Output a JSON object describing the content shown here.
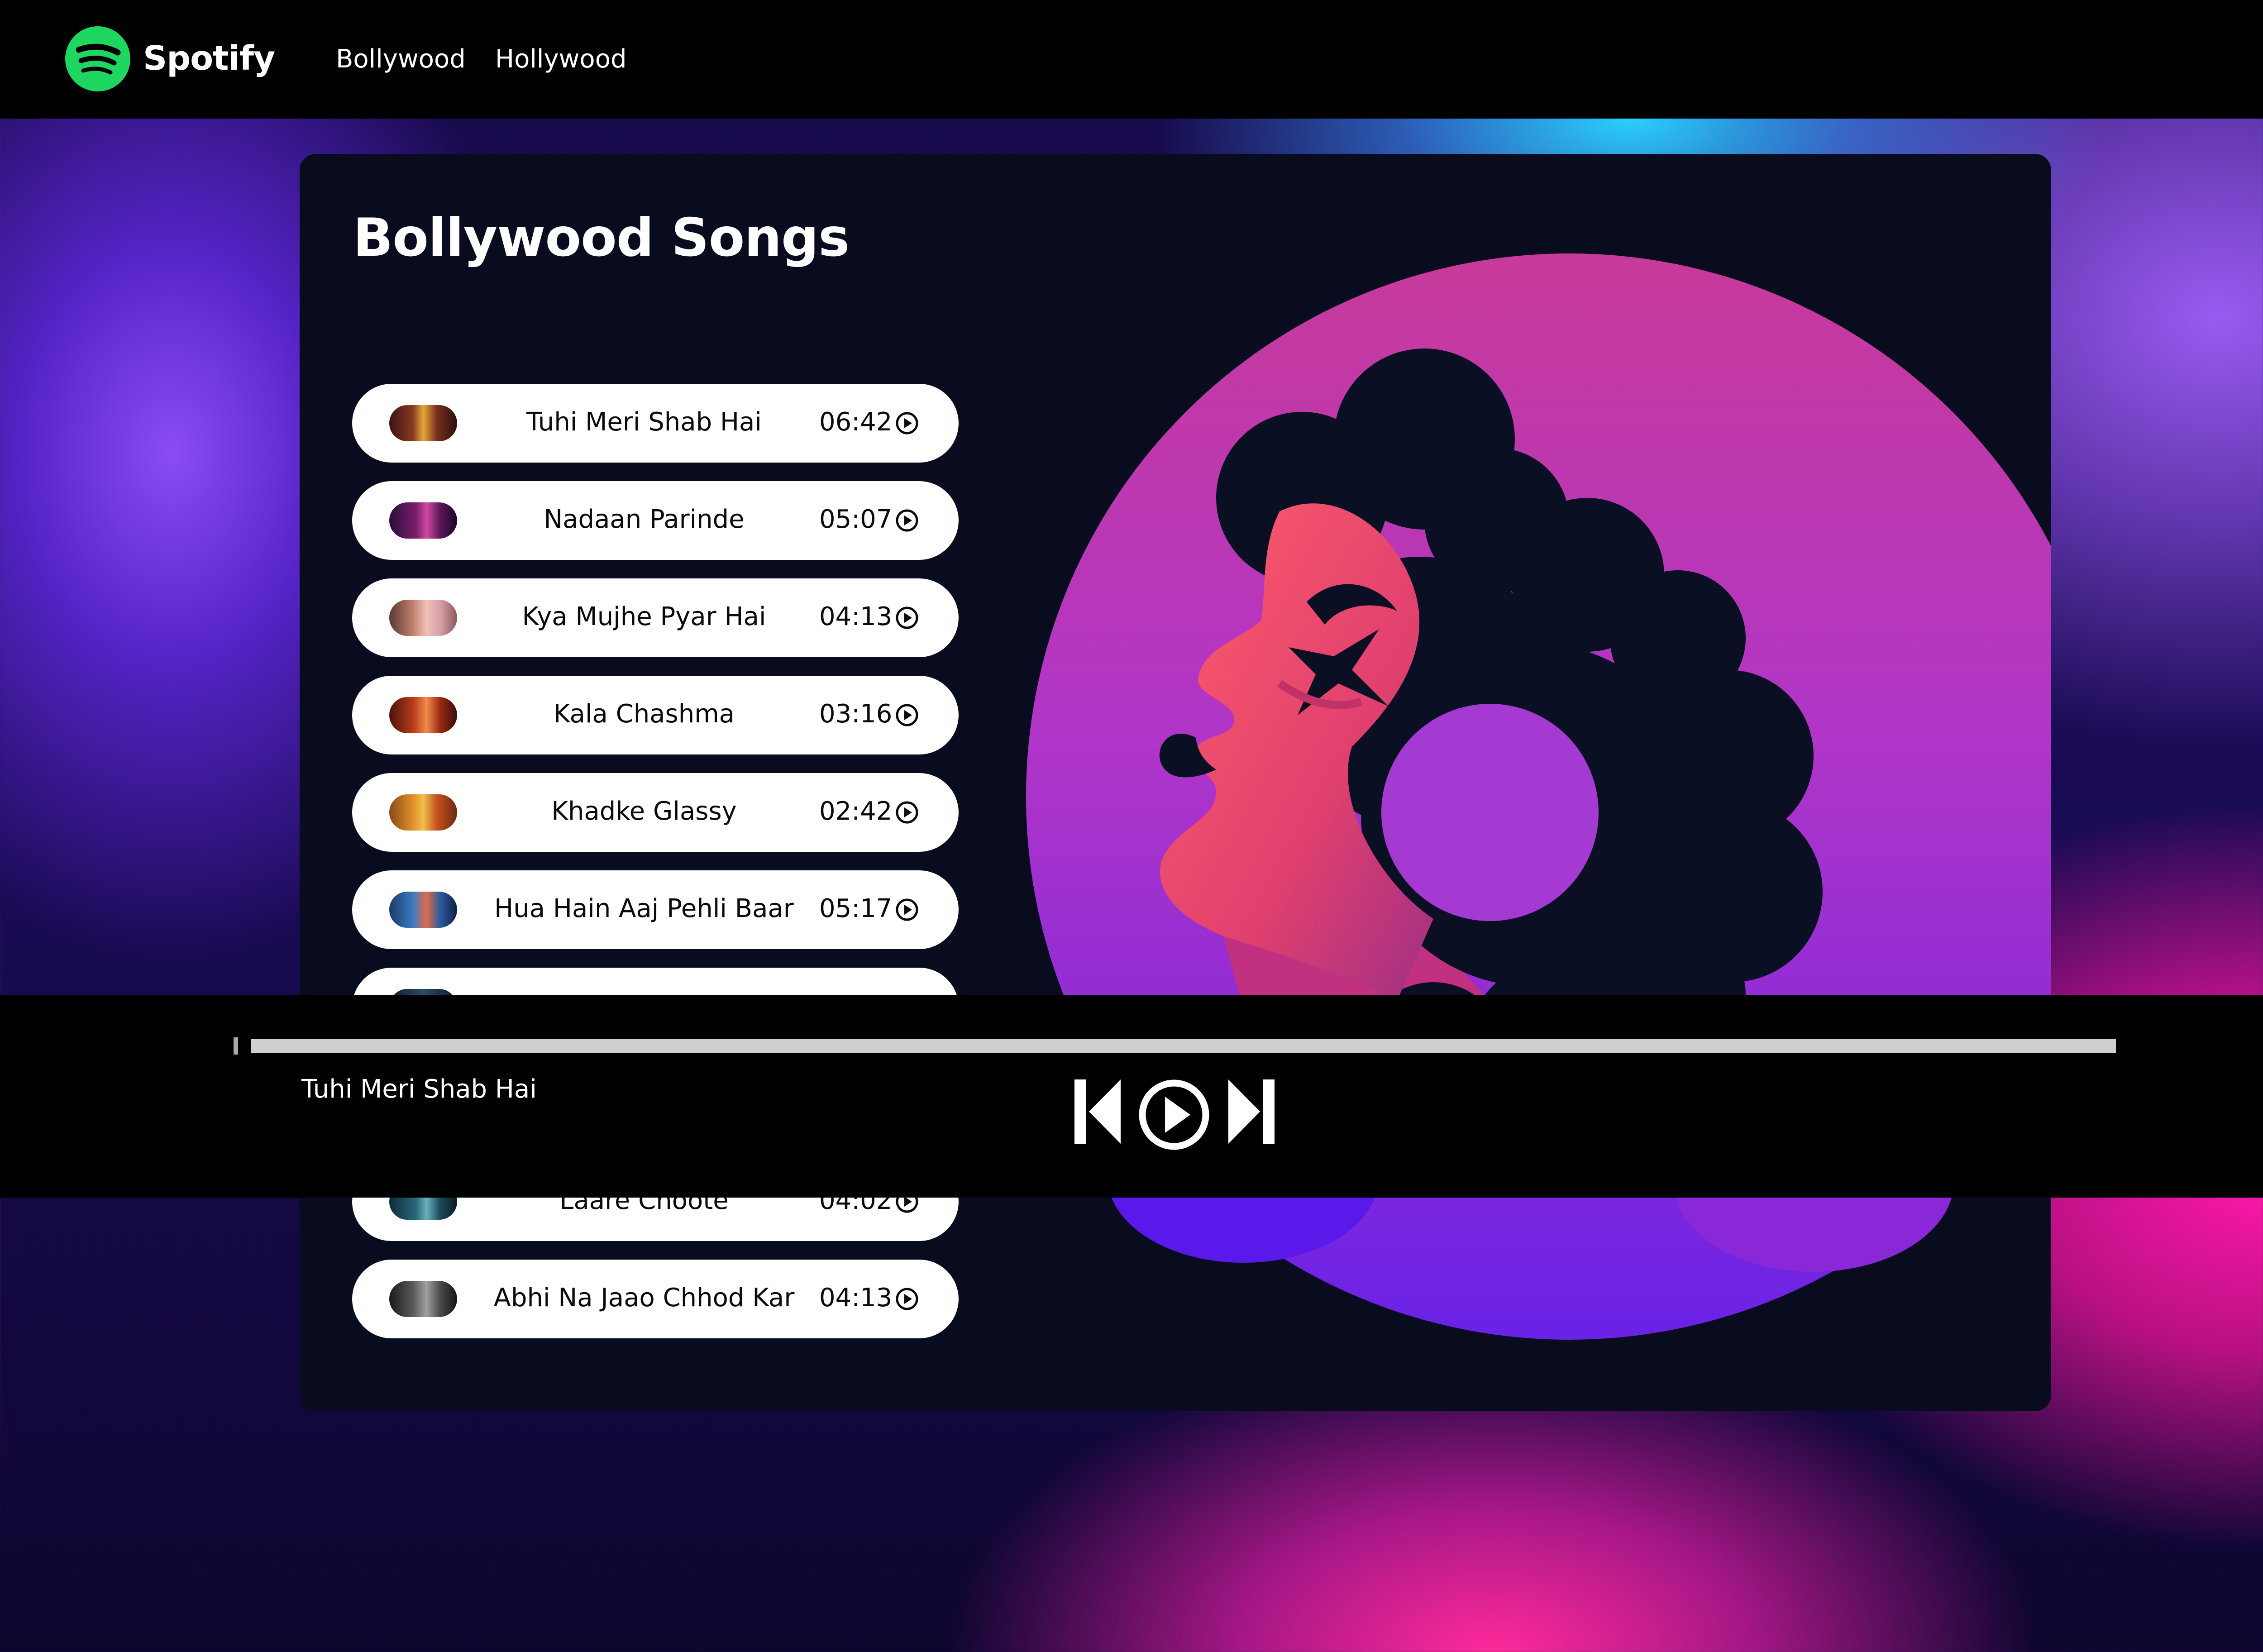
{
  "app": {
    "brand": "Spotify",
    "logo_icon": "spotify-logo-icon",
    "brand_color": "#1ed760"
  },
  "nav": {
    "links": [
      "Bollywood",
      "Hollywood"
    ]
  },
  "main": {
    "title": "Bollywood Songs",
    "songs": [
      {
        "name": "Tuhi Meri Shab Hai",
        "duration": "06:42",
        "icon": "play-circle-icon"
      },
      {
        "name": "Nadaan Parinde",
        "duration": "05:07",
        "icon": "play-circle-icon"
      },
      {
        "name": "Kya Mujhe Pyar Hai",
        "duration": "04:13",
        "icon": "play-circle-icon"
      },
      {
        "name": "Kala Chashma",
        "duration": "03:16",
        "icon": "play-circle-icon"
      },
      {
        "name": "Khadke Glassy",
        "duration": "02:42",
        "icon": "play-circle-icon"
      },
      {
        "name": "Hua Hain Aaj Pehli Baar",
        "duration": "05:17",
        "icon": "play-circle-icon"
      },
      {
        "name": "Laare Choote",
        "duration": "04:02",
        "icon": "play-circle-icon"
      },
      {
        "name": "Abhi Na Jaao Chhod Kar",
        "duration": "04:13",
        "icon": "play-circle-icon"
      }
    ]
  },
  "player": {
    "now_playing": "Tuhi Meri Shab Hai",
    "progress": 0,
    "controls": [
      "skip-back-icon",
      "play-icon",
      "skip-forward-icon"
    ]
  }
}
